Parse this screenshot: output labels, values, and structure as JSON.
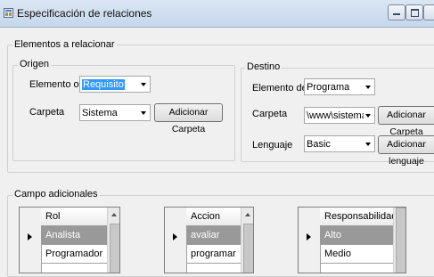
{
  "window": {
    "title": "Especificación de relaciones"
  },
  "elementos": {
    "legend": "Elementos a relacionar",
    "origen": {
      "legend": "Origen",
      "elemento_label": "Elemento origen",
      "elemento_value": "Requisito",
      "carpeta_label": "Carpeta",
      "carpeta_value": "Sistema",
      "adicionar_carpeta": "Adicionar Carpeta"
    },
    "destino": {
      "legend": "Destino",
      "elemento_label": "Elemento destino",
      "elemento_value": "Programa",
      "carpeta_label": "Carpeta",
      "carpeta_value": "\\www\\sistemaBibliot",
      "adicionar_carpeta": "Adicionar Carpeta",
      "lenguaje_label": "Lenguaje",
      "lenguaje_value": "Basic",
      "adicionar_lenguaje": "Adicionar lenguaje"
    }
  },
  "campo": {
    "legend": "Campo adicionales",
    "rol": {
      "header": "Rol",
      "rows": [
        "Analista",
        "Programador"
      ]
    },
    "accion": {
      "header": "Accion",
      "rows": [
        "avaliar",
        "programar"
      ]
    },
    "responsabilidad": {
      "header": "Responsabilidad",
      "rows": [
        "Alto",
        "Medio"
      ]
    }
  },
  "icons": {
    "window": "app-icon",
    "minimize": "minimize-icon",
    "maximize": "maximize-icon",
    "dropdown": "chevron-down-icon",
    "row_pointer": "row-pointer-icon"
  }
}
